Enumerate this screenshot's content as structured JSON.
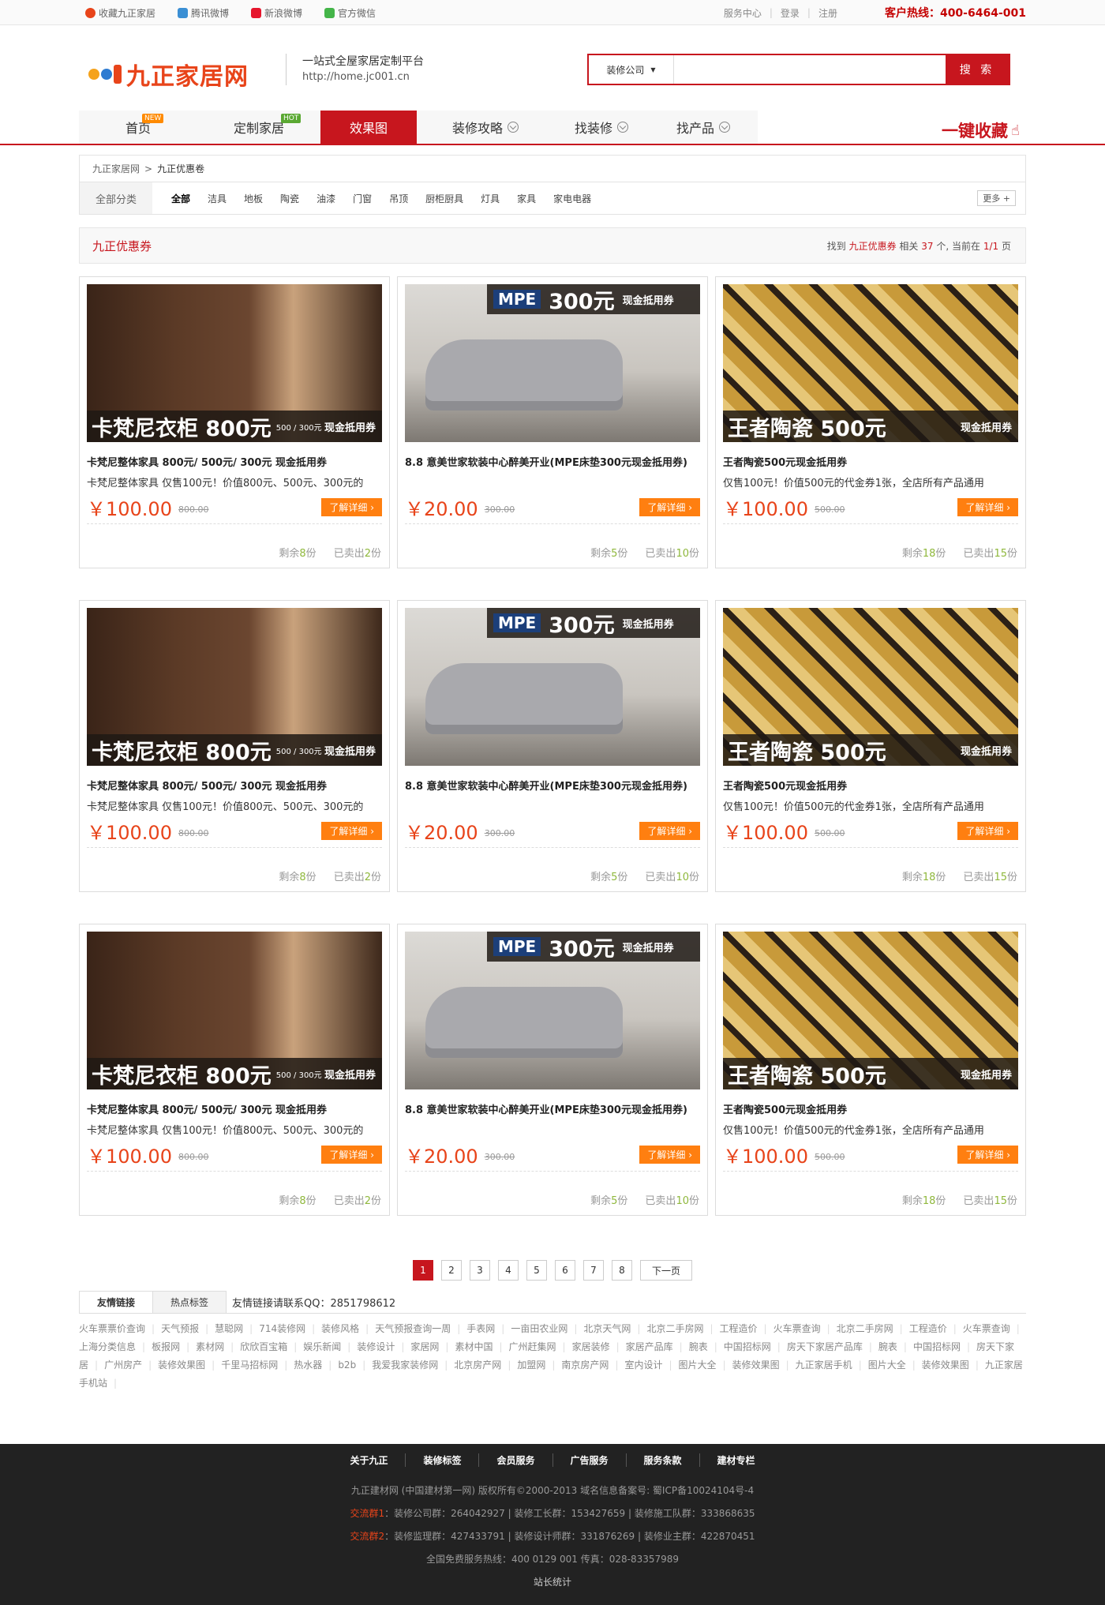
{
  "topbar": {
    "links": [
      "收藏九正家居",
      "腾讯微博",
      "新浪微博",
      "官方微信"
    ],
    "right": [
      "服务中心",
      "登录",
      "注册"
    ],
    "hotline": "客户热线：400-6464-001"
  },
  "header": {
    "logo": "九正家居网",
    "slogan": "一站式全屋家居定制平台",
    "url": "http://home.jc001.cn",
    "search_cat": "装修公司",
    "search_btn": "搜 索"
  },
  "nav": {
    "items": [
      "首页",
      "定制家居",
      "效果图",
      "装修攻略",
      "找装修",
      "找产品"
    ],
    "badges": [
      "NEW",
      "HOT"
    ],
    "fav": "一键收藏"
  },
  "breadcrumb": [
    "九正家居网",
    "九正优惠卷"
  ],
  "filter": {
    "label": "全部分类",
    "options": [
      "全部",
      "洁具",
      "地板",
      "陶瓷",
      "油漆",
      "门窗",
      "吊顶",
      "厨柜厨具",
      "灯具",
      "家具",
      "家电电器"
    ],
    "more": "更多"
  },
  "result": {
    "title": "九正优惠券",
    "info_pre": "找到",
    "keyword": "九正优惠券",
    "info_mid": "相关",
    "count": "37",
    "info_mid2": "个, 当前在",
    "page": "1/1",
    "info_end": "页"
  },
  "cards": [
    {
      "img": "wardrobe",
      "banner": "卡梵尼衣柜 800元",
      "small": "500 / 300元",
      "tag": "现金抵用券",
      "title": "卡梵尼整体家具 800元/ 500元/ 300元 现金抵用券",
      "desc": "卡梵尼整体家具 仅售100元！价值800元、500元、300元的",
      "price": "￥100.00",
      "old": "800.00",
      "btn": "了解详细 ›",
      "remain_pre": "剩余",
      "remain": "8",
      "remain_suf": "份",
      "sold_pre": "已卖出",
      "sold": "2",
      "sold_suf": "份"
    },
    {
      "img": "bed",
      "banner": "300元",
      "small": "",
      "tag": "现金抵用券",
      "title": "8.8 意美世家软装中心醉美开业(MPE床垫300元现金抵用券)",
      "desc": "",
      "price": "￥20.00",
      "old": "300.00",
      "btn": "了解详细 ›",
      "remain_pre": "剩余",
      "remain": "5",
      "remain_suf": "份",
      "sold_pre": "已卖出",
      "sold": "10",
      "sold_suf": "份"
    },
    {
      "img": "tile",
      "banner": "王者陶瓷 500元",
      "small": "",
      "tag": "现金抵用券",
      "title": "王者陶瓷500元现金抵用券",
      "desc": "仅售100元！价值500元的代金券1张，全店所有产品通用",
      "price": "￥100.00",
      "old": "500.00",
      "btn": "了解详细 ›",
      "remain_pre": "剩余",
      "remain": "18",
      "remain_suf": "份",
      "sold_pre": "已卖出",
      "sold": "15",
      "sold_suf": "份"
    }
  ],
  "pager": [
    "1",
    "2",
    "3",
    "4",
    "5",
    "6",
    "7",
    "8",
    "下一页"
  ],
  "links": {
    "tabs": [
      "友情链接",
      "热点标签"
    ],
    "note": "友情链接请联系QQ：2851798612",
    "items": [
      "火车票票价查询",
      "天气预报",
      "慧聪网",
      "714装修网",
      "装修风格",
      "天气预报查询一周",
      "手表网",
      "一亩田农业网",
      "北京天气网",
      "北京二手房网",
      "工程造价",
      "火车票查询",
      "北京二手房网",
      "工程造价",
      "火车票查询",
      "上海分类信息",
      "板报网",
      "素材网",
      "欣欣百宝箱",
      "娱乐新闻",
      "装修设计",
      "家居网",
      "素材中国",
      "广州赶集网",
      "家居装修",
      "家居产品库",
      "腕表",
      "中国招标网",
      "房天下家居产品库",
      "腕表",
      "中国招标网",
      "房天下家居",
      "广州房产",
      "装修效果图",
      "千里马招标网",
      "热水器",
      "b2b",
      "我爱我家装修网",
      "北京房产网",
      "加盟网",
      "南京房产网",
      "室内设计",
      "图片大全",
      "装修效果图",
      "九正家居手机",
      "图片大全",
      "装修效果图",
      "九正家居手机站"
    ]
  },
  "footer": {
    "nav": [
      "关于九正",
      "装修标签",
      "会员服务",
      "广告服务",
      "服务条款",
      "建材专栏"
    ],
    "copyright": "九正建材网 (中国建材第一网) 版权所有©2000-2013   域名信息备案号: 蜀ICP备10024104号-4",
    "group1_label": "交流群1",
    "group1": "：装修公司群：264042927 | 装修工长群：153427659 | 装修施工队群：333868635",
    "group2_label": "交流群2",
    "group2": "：装修监理群：427433791 | 装修设计师群：331876269 | 装修业主群：422870451",
    "service": "全国免费服务热线：400 0129 001 传真：028-83357989",
    "stats": "站长统计"
  },
  "colors": {
    "brand": "#c7161e",
    "accent": "#ff7f10",
    "price": "#e8441a",
    "stock": "#8fb83c"
  }
}
